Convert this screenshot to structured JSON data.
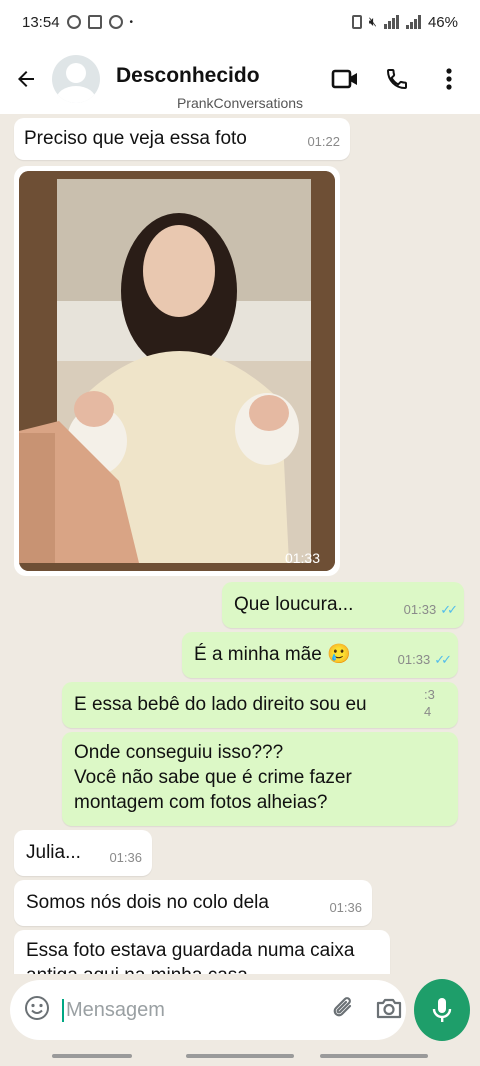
{
  "status_bar": {
    "time": "13:54",
    "battery": "46%"
  },
  "header": {
    "contact_name": "Desconhecido",
    "watermark": "PrankConversations"
  },
  "messages": [
    {
      "dir": "in",
      "text": "Preciso que veja essa foto",
      "time": "01:22"
    },
    {
      "dir": "in",
      "type": "photo",
      "time": "01:33"
    },
    {
      "dir": "out",
      "text": "Que loucura...",
      "time": "01:33"
    },
    {
      "dir": "out",
      "text": "É a minha mãe 🥲",
      "time": "01:33"
    },
    {
      "dir": "out",
      "text": "E essa bebê do lado direito sou eu",
      "time": ":3 4"
    },
    {
      "dir": "out",
      "text": "Onde conseguiu isso???",
      "text2": "Você não sabe que é crime fazer",
      "text3": "montagem com fotos alheias?"
    },
    {
      "dir": "in",
      "text": "Julia...",
      "time": "01:36"
    },
    {
      "dir": "in",
      "text": "Somos nós dois no colo dela",
      "time": "01:36"
    },
    {
      "dir": "in",
      "text": "Essa foto estava guardada numa caixa",
      "text2": "antiga aqui na minha casa"
    }
  ],
  "composer": {
    "placeholder": "Mensagem"
  },
  "colors": {
    "incoming": "#ffffff",
    "outgoing": "#dcf8c6",
    "accent": "#1e9e6a",
    "wallpaper": "#efeae2"
  },
  "icons": [
    "back-arrow-icon",
    "video-call-icon",
    "phone-icon",
    "more-vert-icon",
    "emoji-icon",
    "attach-icon",
    "camera-icon",
    "mic-icon"
  ]
}
